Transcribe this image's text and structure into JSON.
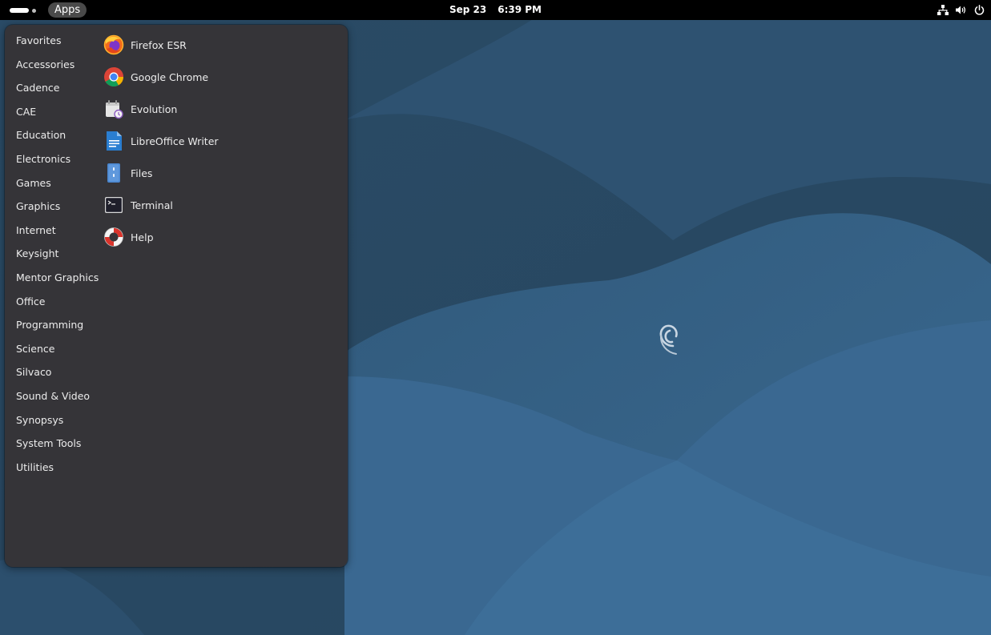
{
  "topbar": {
    "apps_label": "Apps",
    "date": "Sep 23",
    "time": "6:39 PM"
  },
  "tray": {
    "icons": [
      "network-icon",
      "volume-icon",
      "power-icon"
    ]
  },
  "menu": {
    "categories": [
      "Favorites",
      "Accessories",
      "Cadence",
      "CAE",
      "Education",
      "Electronics",
      "Games",
      "Graphics",
      "Internet",
      "Keysight",
      "Mentor Graphics",
      "Office",
      "Programming",
      "Science",
      "Silvaco",
      "Sound & Video",
      "Synopsys",
      "System Tools",
      "Utilities"
    ],
    "apps": [
      {
        "label": "Firefox ESR",
        "icon": "firefox-icon"
      },
      {
        "label": "Google Chrome",
        "icon": "chrome-icon"
      },
      {
        "label": "Evolution",
        "icon": "evolution-icon"
      },
      {
        "label": "LibreOffice Writer",
        "icon": "libreoffice-writer-icon"
      },
      {
        "label": "Files",
        "icon": "files-icon"
      },
      {
        "label": "Terminal",
        "icon": "terminal-icon"
      },
      {
        "label": "Help",
        "icon": "help-icon"
      }
    ]
  },
  "colors": {
    "panel": "#000000",
    "menu_bg": "#353438",
    "wallpaper_dark": "#23435c",
    "wallpaper_light": "#3b6a92"
  }
}
